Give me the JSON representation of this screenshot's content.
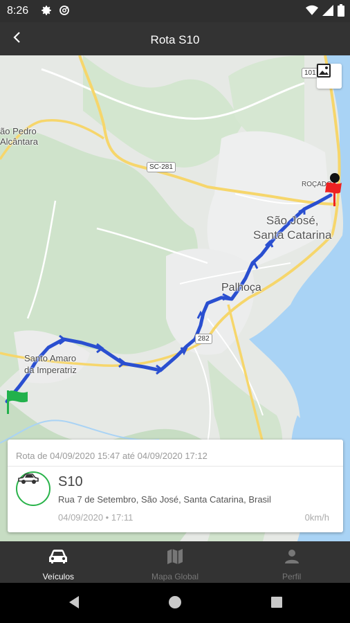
{
  "status_bar": {
    "time": "8:26",
    "left_icons": [
      "gear-icon",
      "sync-icon"
    ],
    "right_icons": [
      "wifi-icon",
      "signal-icon",
      "battery-icon"
    ]
  },
  "app_bar": {
    "title": "Rota S10",
    "back_icon": "chevron-left-icon"
  },
  "map": {
    "labels": {
      "sao_pedro_line1": "ão Pedro",
      "sao_pedro_line2": "Alcântara",
      "sao_jose_line1": "São José,",
      "sao_jose_line2": "Santa Catarina",
      "palhoca": "Palhoça",
      "santo_amaro_line1": "Santo Amaro",
      "santo_amaro_line2": "da Imperatriz",
      "rocado": "ROÇADO"
    },
    "road_shields": {
      "sc281": "SC-281",
      "br101": "101",
      "br282": "282"
    },
    "layers_icon": "image-layers-icon",
    "start_marker_icon": "flag-icon",
    "end_marker_icon": "pin-icon",
    "route_color": "#2a4fd0",
    "water_color": "#a9d3f5"
  },
  "card": {
    "period": "Rota de 04/09/2020 15:47 até 04/09/2020 17:12",
    "vehicle_icon": "car-icon",
    "vehicle_name": "S10",
    "address": "Rua 7 de Setembro, São José, Santa Catarina, Brasil",
    "datetime": "04/09/2020 • 17:11",
    "speed": "0km/h",
    "accent_color": "#29b34a"
  },
  "bottom_nav": {
    "items": [
      {
        "label": "Veículos",
        "icon": "car-icon",
        "active": true
      },
      {
        "label": "Mapa Global",
        "icon": "map-icon",
        "active": false
      },
      {
        "label": "Perfil",
        "icon": "person-icon",
        "active": false
      }
    ]
  },
  "system_nav": {
    "icons": [
      "back-triangle-icon",
      "home-circle-icon",
      "recents-square-icon"
    ]
  }
}
